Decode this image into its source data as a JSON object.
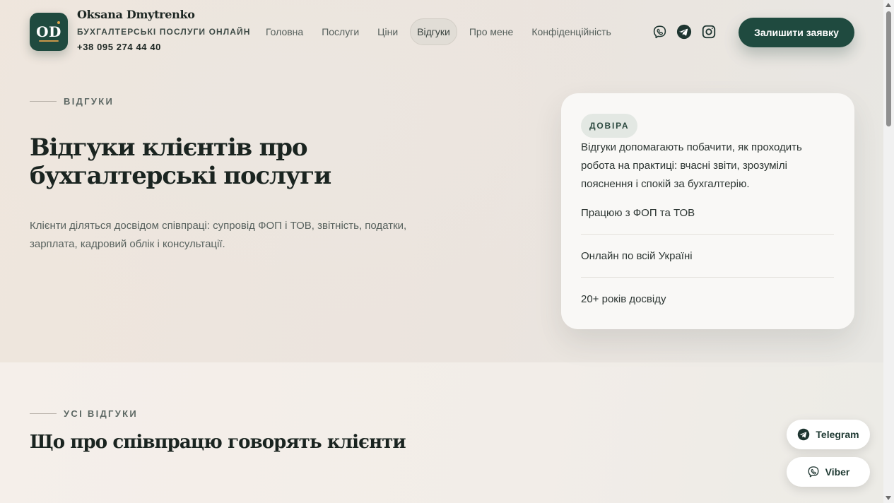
{
  "header": {
    "logo_text": "OD",
    "brand_name": "Oksana Dmytrenko",
    "brand_subtitle": "БУХГАЛТЕРСЬКІ ПОСЛУГИ ОНЛАЙН",
    "phone": "+38 095 274 44 40",
    "nav": [
      {
        "label": "Головна",
        "active": false
      },
      {
        "label": "Послуги",
        "active": false
      },
      {
        "label": "Ціни",
        "active": false
      },
      {
        "label": "Відгуки",
        "active": true
      },
      {
        "label": "Про мене",
        "active": false
      },
      {
        "label": "Конфіденційність",
        "active": false
      }
    ],
    "social_icons": [
      "viber-icon",
      "telegram-icon",
      "instagram-icon"
    ],
    "cta_label": "Залишити заявку"
  },
  "hero": {
    "eyebrow": "ВІДГУКИ",
    "title_line1": "Відгуки клієнтів про",
    "title_line2": "бухгалтерські послуги",
    "description": "Клієнти діляться досвідом співпраці: супровід ФОП і ТОВ, звітність, податки, зарплата, кадровий облік і консультації."
  },
  "trust_card": {
    "badge": "ДОВІРА",
    "text": "Відгуки допомагають побачити, як проходить робота на практиці: вчасні звіти, зрозумілі пояснення і спокій за бухгалтерію.",
    "features": [
      "Працюю з ФОП та ТОВ",
      "Онлайн по всій Україні",
      "20+ років досвіду"
    ]
  },
  "reviews_section": {
    "eyebrow": "УСІ ВІДГУКИ",
    "title": "Що про співпрацю говорять клієнти"
  },
  "floating": {
    "telegram_label": "Telegram",
    "viber_label": "Viber"
  },
  "colors": {
    "accent": "#1f4a3f",
    "logo_mark": "#c9974a",
    "background": "#efe7df"
  }
}
